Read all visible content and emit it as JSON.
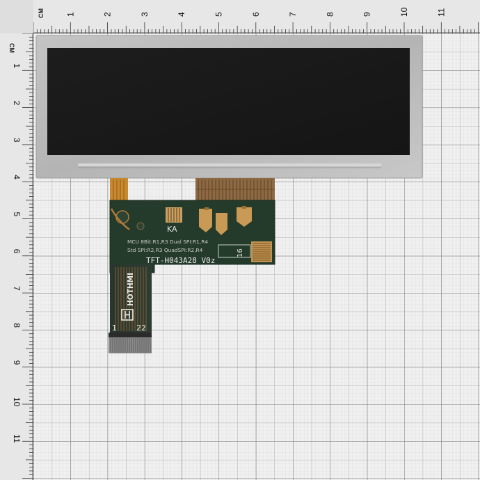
{
  "ruler": {
    "unit_label": "CM",
    "top_numbers": [
      "1",
      "2",
      "3",
      "4",
      "5",
      "6",
      "7",
      "8",
      "9",
      "10",
      "11"
    ],
    "left_numbers": [
      "1",
      "2",
      "3",
      "4",
      "5",
      "6",
      "7",
      "8",
      "9",
      "10",
      "11"
    ]
  },
  "lcd": {
    "model": "TFT-H043A28 V0z",
    "screen_state": "off"
  },
  "pcb_labels": {
    "ka": "KA",
    "mode_line1": "MCU 8Bit:R1,R3  Dual SPI:R1,R4",
    "mode_line2": "Std SPI:R2,R3    QuadSPI:R2,R4",
    "connector_small": "16",
    "brand": "HOTHMI",
    "pin_first": "1",
    "pin_last": "22"
  },
  "colors": {
    "background": "#c9c9c9",
    "grid_minor": "#e0e0e0",
    "grid_major": "#9a9a9a",
    "bezel": "#b9b9b9",
    "screen": "#1b1b1b",
    "pcb": "#263a2b",
    "copper": "#b07a3b"
  }
}
